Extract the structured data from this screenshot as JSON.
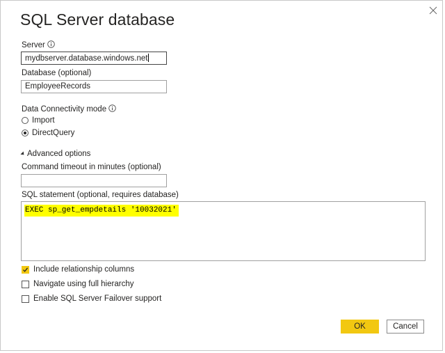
{
  "dialog": {
    "title": "SQL Server database",
    "close_icon": "close-icon"
  },
  "server": {
    "label": "Server",
    "value": "mydbserver.database.windows.net"
  },
  "database": {
    "label": "Database (optional)",
    "value": "EmployeeRecords"
  },
  "connectivity": {
    "label": "Data Connectivity mode",
    "options": [
      {
        "label": "Import",
        "selected": false
      },
      {
        "label": "DirectQuery",
        "selected": true
      }
    ]
  },
  "advanced": {
    "label": "Advanced options",
    "expanded": true,
    "timeout_label": "Command timeout in minutes (optional)",
    "timeout_value": "",
    "sql_label": "SQL statement (optional, requires database)",
    "sql_value": "EXEC sp_get_empdetails '10032021'",
    "sql_highlight_color": "#ffff00",
    "checkboxes": [
      {
        "label": "Include relationship columns",
        "checked": true
      },
      {
        "label": "Navigate using full hierarchy",
        "checked": false
      },
      {
        "label": "Enable SQL Server Failover support",
        "checked": false
      }
    ]
  },
  "buttons": {
    "ok_label": "OK",
    "cancel_label": "Cancel"
  },
  "colors": {
    "accent": "#f2c811",
    "text": "#252423",
    "border": "#a0a0a0"
  }
}
